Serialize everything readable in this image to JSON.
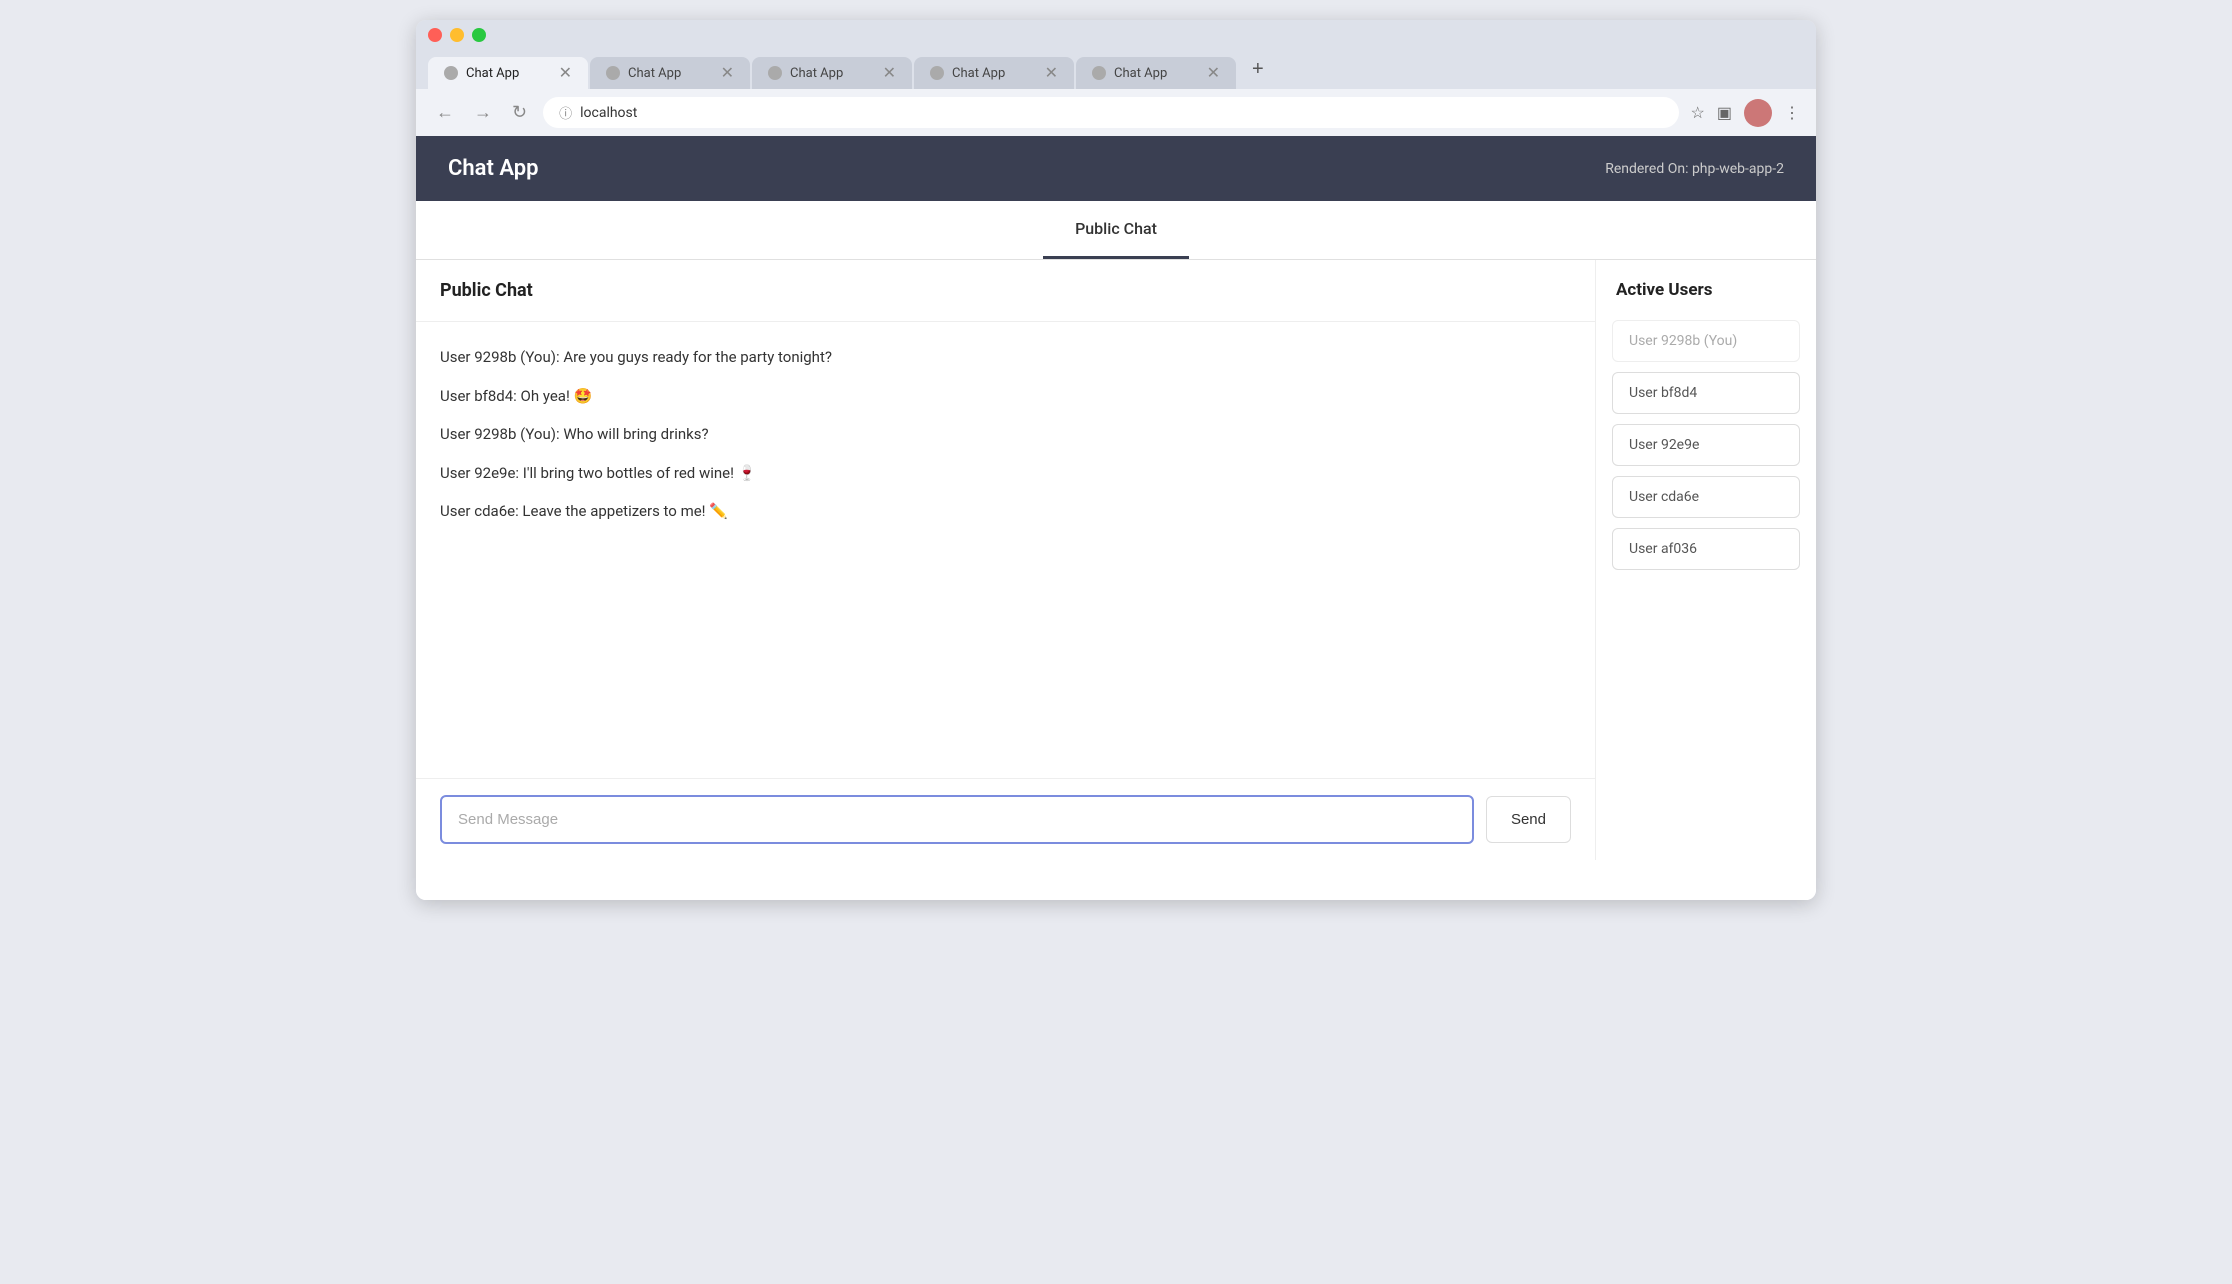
{
  "browser": {
    "tabs": [
      {
        "label": "Chat App",
        "active": true
      },
      {
        "label": "Chat App",
        "active": false
      },
      {
        "label": "Chat App",
        "active": false
      },
      {
        "label": "Chat App",
        "active": false
      },
      {
        "label": "Chat App",
        "active": false
      }
    ],
    "address": "localhost"
  },
  "app": {
    "title": "Chat App",
    "rendered_on": "Rendered On: php-web-app-2",
    "tab_nav": "Public Chat",
    "chat_section_title": "Public Chat",
    "active_users_title": "Active Users"
  },
  "messages": [
    {
      "text": "User 9298b (You): Are you guys ready for the party tonight?"
    },
    {
      "text": "User bf8d4: Oh yea! 🤩"
    },
    {
      "text": "User 9298b (You): Who will bring drinks?"
    },
    {
      "text": "User 92e9e: I'll bring two bottles of red wine! 🍷"
    },
    {
      "text": "User cda6e: Leave the appetizers to me! ✏️"
    }
  ],
  "input": {
    "placeholder": "Send Message",
    "send_label": "Send"
  },
  "active_users": [
    {
      "name": "User 9298b (You)",
      "you": true
    },
    {
      "name": "User bf8d4",
      "you": false
    },
    {
      "name": "User 92e9e",
      "you": false
    },
    {
      "name": "User cda6e",
      "you": false
    },
    {
      "name": "User af036",
      "you": false
    }
  ]
}
